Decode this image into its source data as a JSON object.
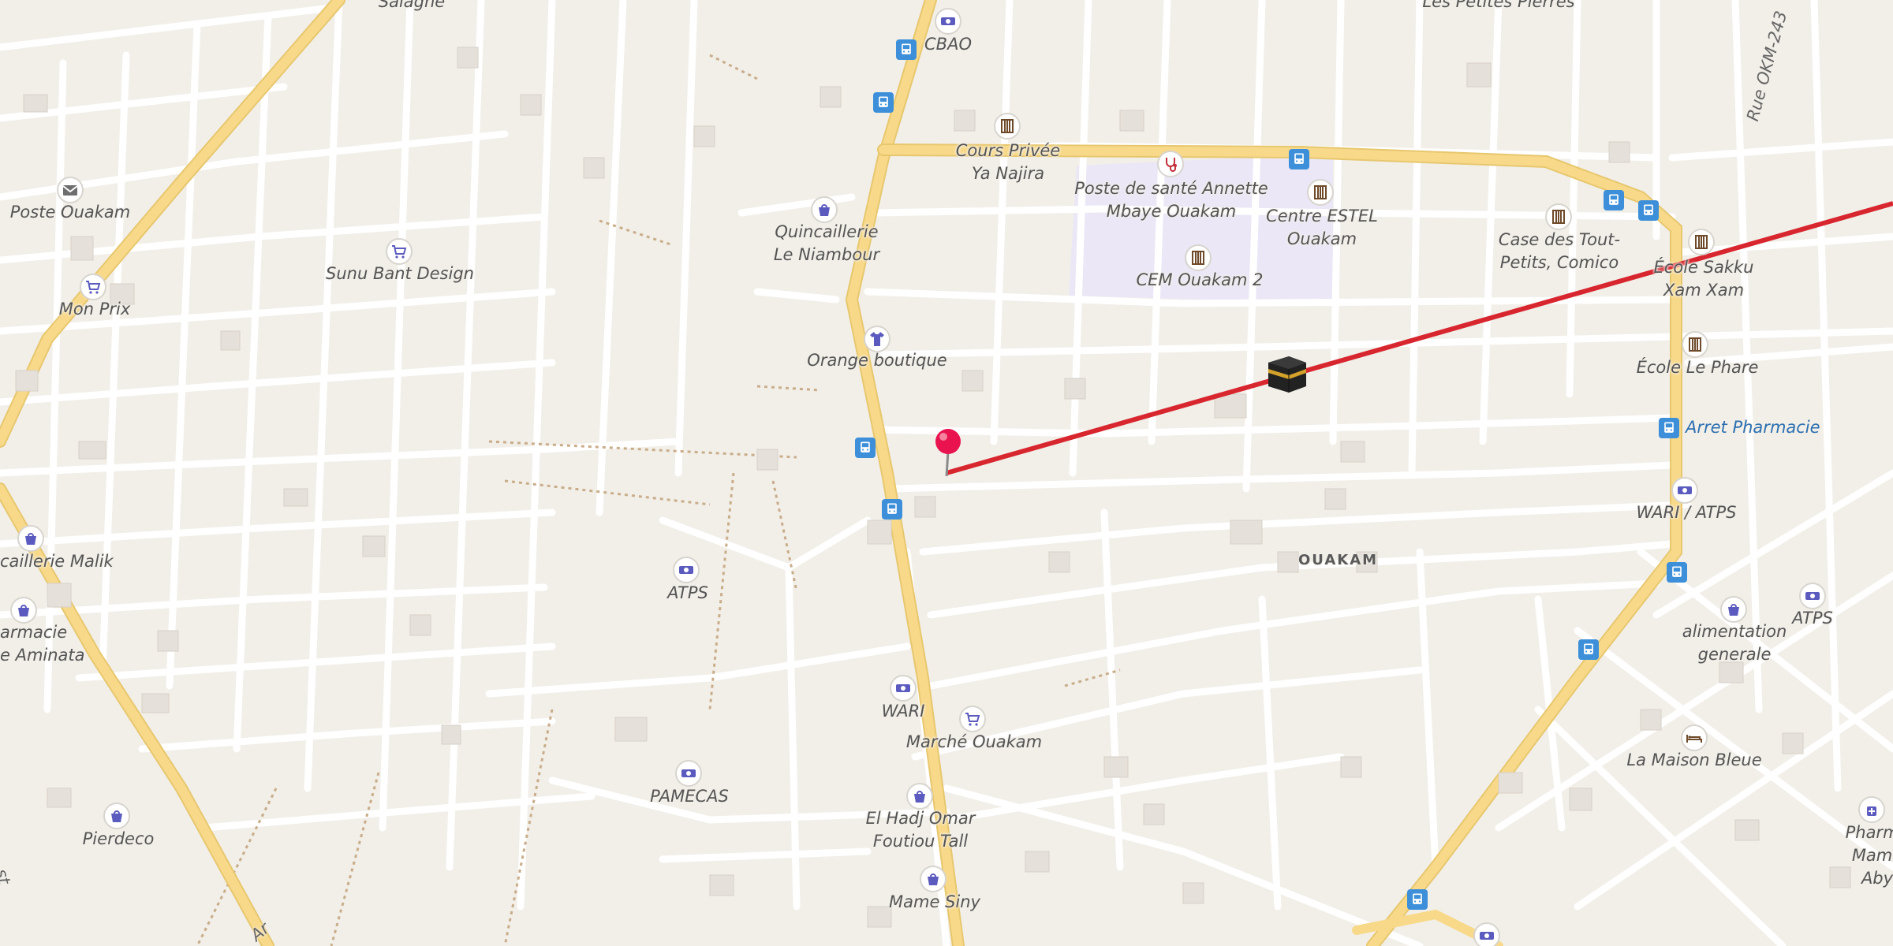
{
  "map": {
    "district_label": "OUAKAM",
    "street_labels": {
      "rue_okm": "Rue OKM-243",
      "bottom_left_a": "Ar",
      "bottom_left_b": "st"
    },
    "top_labels": {
      "salagne": "Salagne",
      "petites_pierres": "Les Petites Pierres"
    },
    "places": {
      "cbao": "CBAO",
      "cours_privee": "Cours Privée\nYa Najira",
      "poste_sante": "Poste de santé Annette\nMbaye Ouakam",
      "centre_estel": "Centre ESTEL\nOuakam",
      "case_tout_petits": "Case des Tout-\nPetits, Comico",
      "ecole_sakku": "École Sakku\nXam Xam",
      "ecole_phare": "École Le Phare",
      "arret_pharmacie": "Arret Pharmacie",
      "wari_atps": "WARI / ATPS",
      "atps_right": "ATPS",
      "alimentation": "alimentation\ngenerale",
      "maison_bleue": "La Maison Bleue",
      "pharmacie_mame_aby": "Pharma\nMame Aby",
      "poste_ouakam": "Poste Ouakam",
      "sunu_bant": "Sunu Bant Design",
      "mon_prix": "Mon Prix",
      "quincaillerie_niambour": "Quincaillerie\nLe Niambour",
      "cem_ouakam": "CEM Ouakam 2",
      "orange_boutique": "Orange boutique",
      "quincaillerie_malik": "caillerie Malik",
      "pharmacie_aminata": "armacie\ne Aminata",
      "atps_center": "ATPS",
      "wari": "WARI",
      "marche_ouakam": "Marché Ouakam",
      "pamecas": "PAMECAS",
      "el_hadj": "El Hadj Omar\nFoutiou Tall",
      "mame_siny": "Mame Siny",
      "pierdeco": "Pierdeco"
    },
    "icons": {
      "pin": "map-pin-icon",
      "destination": "kaaba-icon",
      "bus": "bus-stop-icon",
      "bank": "bank-icon",
      "school": "school-icon",
      "shop": "shop-icon",
      "cart": "cart-icon",
      "post": "post-office-icon",
      "clothes": "clothes-icon",
      "doctor": "doctor-icon",
      "hotel": "hotel-icon",
      "pharmacy": "pharmacy-icon"
    },
    "colors": {
      "background": "#f2efe9",
      "road": "#ffffff",
      "main_road": "#f8d98a",
      "direction_line": "#d8262f",
      "school_zone": "#ebe7f6",
      "poi_icon": "#5b5bbf",
      "bus_stop": "#3d8fd9",
      "pin": "#e8134f"
    }
  }
}
